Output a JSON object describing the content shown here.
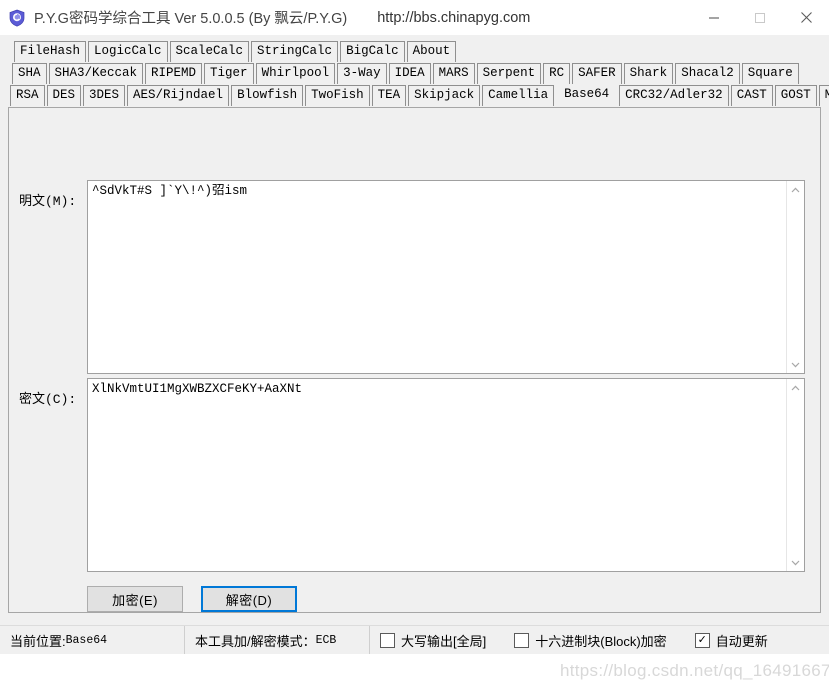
{
  "window": {
    "icon": "shield-icon",
    "title": "P.Y.G密码学综合工具 Ver 5.0.0.5 (By 飘云/P.Y.G)",
    "url": "http://bbs.chinapyg.com",
    "minimize_label": "—",
    "maximize_label": "□",
    "close_label": "✕"
  },
  "tabs": {
    "row1": [
      {
        "label": "FileHash",
        "selected": false
      },
      {
        "label": "LogicCalc",
        "selected": false
      },
      {
        "label": "ScaleCalc",
        "selected": false
      },
      {
        "label": "StringCalc",
        "selected": false
      },
      {
        "label": "BigCalc",
        "selected": false
      },
      {
        "label": "About",
        "selected": false
      }
    ],
    "row2": [
      {
        "label": "SHA",
        "selected": false
      },
      {
        "label": "SHA3/Keccak",
        "selected": false
      },
      {
        "label": "RIPEMD",
        "selected": false
      },
      {
        "label": "Tiger",
        "selected": false
      },
      {
        "label": "Whirlpool",
        "selected": false
      },
      {
        "label": "3-Way",
        "selected": false
      },
      {
        "label": "IDEA",
        "selected": false
      },
      {
        "label": "MARS",
        "selected": false
      },
      {
        "label": "Serpent",
        "selected": false
      },
      {
        "label": "RC",
        "selected": false
      },
      {
        "label": "SAFER",
        "selected": false
      },
      {
        "label": "Shark",
        "selected": false
      },
      {
        "label": "Shacal2",
        "selected": false
      },
      {
        "label": "Square",
        "selected": false
      }
    ],
    "row3": [
      {
        "label": "RSA",
        "selected": false
      },
      {
        "label": "DES",
        "selected": false
      },
      {
        "label": "3DES",
        "selected": false
      },
      {
        "label": "AES/Rijndael",
        "selected": false
      },
      {
        "label": "Blowfish",
        "selected": false
      },
      {
        "label": "TwoFish",
        "selected": false
      },
      {
        "label": "TEA",
        "selected": false
      },
      {
        "label": "Skipjack",
        "selected": false
      },
      {
        "label": "Camellia",
        "selected": false
      },
      {
        "label": "Base64",
        "selected": true
      },
      {
        "label": "CRC32/Adler32",
        "selected": false
      },
      {
        "label": "CAST",
        "selected": false
      },
      {
        "label": "GOST",
        "selected": false
      },
      {
        "label": "MD",
        "selected": false
      }
    ]
  },
  "form": {
    "plaintext_label": "明文(M):",
    "plaintext_value": "^SdVkT#S ]`Y\\!^)弨ism",
    "ciphertext_label": "密文(C):",
    "ciphertext_value": "XlNkVmtUI1MgXWBZXCFeKY+AaXNt",
    "scroll_up": "⌃",
    "scroll_down": "⌄",
    "encrypt_label": "加密(E)",
    "decrypt_label": "解密(D)",
    "focus_color": "#0078d7"
  },
  "status": {
    "position_prefix": "当前位置:",
    "position_value": "Base64",
    "mode_prefix": "本工具加/解密模式：",
    "mode_value": "ECB",
    "checkboxes": [
      {
        "label": "大写输出[全局]",
        "checked": false,
        "mark": ""
      },
      {
        "label": "十六进制块(Block)加密",
        "checked": false,
        "mark": ""
      },
      {
        "label": "自动更新",
        "checked": true,
        "mark": "✓"
      }
    ],
    "watermark": "https://blog.csdn.net/qq_16491667"
  }
}
